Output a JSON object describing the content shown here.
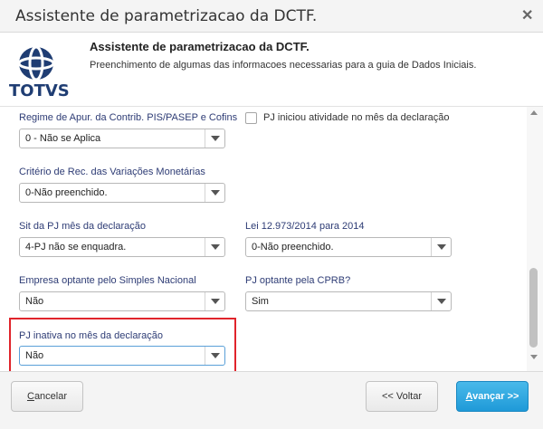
{
  "window": {
    "title": "Assistente de parametrizacao da DCTF."
  },
  "header": {
    "logo_text": "TOTVS",
    "title": "Assistente de parametrizacao da DCTF.",
    "subtitle": "Preenchimento de algumas das informacoes necessarias para a guia de Dados Iniciais."
  },
  "fields": {
    "regime": {
      "label": "Regime de Apur. da Contrib. PIS/PASEP e Cofins",
      "value": "0 - Não se Aplica"
    },
    "pj_inicio": {
      "label": "PJ iniciou atividade no mês da declaração",
      "checked": false
    },
    "criterio": {
      "label": "Critério de Rec. das Variações Monetárias",
      "value": "0-Não preenchido."
    },
    "sit_pj": {
      "label": "Sit da PJ mês da declaração",
      "value": "4-PJ não se enquadra."
    },
    "lei": {
      "label": "Lei 12.973/2014 para 2014",
      "value": "0-Não preenchido."
    },
    "simples": {
      "label": "Empresa optante pelo Simples Nacional",
      "value": "Não"
    },
    "cprb": {
      "label": "PJ optante pela CPRB?",
      "value": "Sim"
    },
    "inativa": {
      "label": "PJ inativa no mês da declaração",
      "value": "Não"
    }
  },
  "footer": {
    "cancel_label": "ancelar",
    "cancel_mnemonic": "C",
    "back_label": "<< Voltar",
    "next_label": "vançar >>",
    "next_mnemonic": "A"
  },
  "colors": {
    "label": "#2e3c75",
    "highlight": "#e0242b",
    "primary": "#1f9ad8"
  }
}
